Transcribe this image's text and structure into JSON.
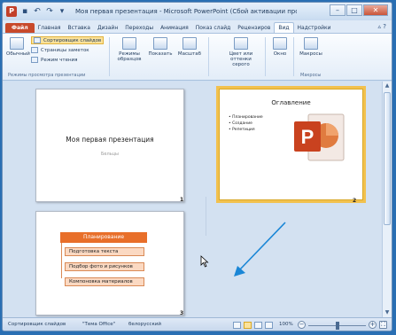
{
  "window": {
    "title": "Моя первая презентация - Microsoft PowerPoint (Сбой активации прод...",
    "app_icon": "P",
    "controls": [
      "minimize-icon",
      "maximize-icon",
      "close-icon"
    ]
  },
  "tabs": [
    {
      "label": "Файл",
      "type": "file"
    },
    {
      "label": "Главная"
    },
    {
      "label": "Вставка"
    },
    {
      "label": "Дизайн"
    },
    {
      "label": "Переходы"
    },
    {
      "label": "Анимация"
    },
    {
      "label": "Показ слайд"
    },
    {
      "label": "Рецензиров"
    },
    {
      "label": "Вид",
      "active": true
    },
    {
      "label": "Надстройки"
    }
  ],
  "ribbon": {
    "normal_label": "Обычный",
    "slide_sorter_label": "Сортировщик слайдов",
    "notes_page_label": "Страницы заметок",
    "reading_view_label": "Режим чтения",
    "group_views_label": "Режимы просмотра презентации",
    "master_views_label": "Режимы образцов",
    "show_label": "Показать",
    "zoom_label": "Масштаб",
    "color_label": "Цвет или оттенки серого",
    "window_label": "Окно",
    "macros_label": "Макросы",
    "group_macros_label": "Макросы"
  },
  "slides": [
    {
      "number": "1",
      "title": "Моя первая презентация",
      "subtitle": "Бельцы"
    },
    {
      "number": "2",
      "title": "Оглавление",
      "bullets": [
        "Планирование",
        "Создание",
        "Репетиция"
      ]
    },
    {
      "number": "3",
      "header": "Планирование",
      "items": [
        "Подготовка текста",
        "Подбор фото и рисунков",
        "Компоновка материалов"
      ]
    }
  ],
  "statusbar": {
    "view_name": "Сортировщик слайдов",
    "theme": "\"Тема Office\"",
    "language": "белорусский",
    "zoom": "100%"
  },
  "colors": {
    "file_tab": "#c84a2b",
    "selection": "#f2c14e",
    "slide3_header": "#e86f2a",
    "annotation_arrow": "#1a86d6"
  }
}
